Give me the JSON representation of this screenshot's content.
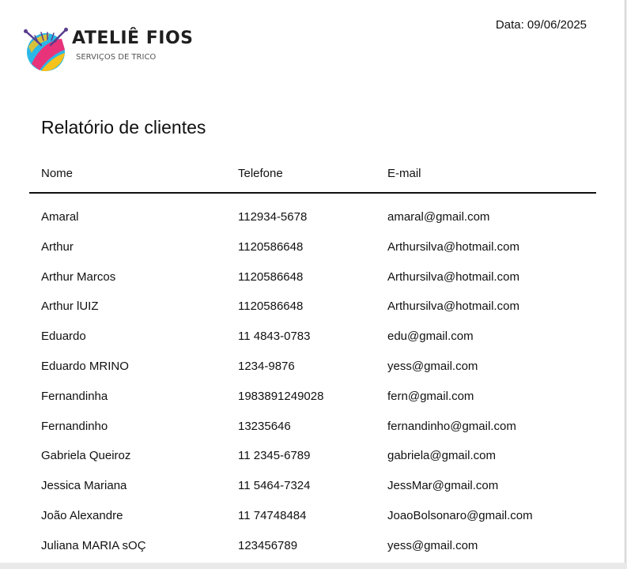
{
  "header": {
    "brand": "ATELIÊ FIOS",
    "tagline": "SERVIÇOS DE TRICO",
    "logo_icon": "yarn-ball-knitting-needles-icon",
    "date_text": "Data: 09/06/2025"
  },
  "report": {
    "title": "Relatório de clientes",
    "columns": {
      "name": "Nome",
      "phone": "Telefone",
      "email": "E-mail"
    },
    "rows": [
      {
        "name": "Amaral",
        "phone": "112934-5678",
        "email": "amaral@gmail.com"
      },
      {
        "name": "Arthur",
        "phone": "1120586648",
        "email": "Arthursilva@hotmail.com"
      },
      {
        "name": "Arthur Marcos",
        "phone": "1120586648",
        "email": "Arthursilva@hotmail.com"
      },
      {
        "name": "Arthur lUIZ",
        "phone": "1120586648",
        "email": "Arthursilva@hotmail.com"
      },
      {
        "name": "Eduardo",
        "phone": "11 4843-0783",
        "email": "edu@gmail.com"
      },
      {
        "name": "Eduardo MRINO",
        "phone": "1234-9876",
        "email": "yess@gmail.com"
      },
      {
        "name": "Fernandinha",
        "phone": "1983891249028",
        "email": "fern@gmail.com"
      },
      {
        "name": "Fernandinho",
        "phone": "13235646",
        "email": "fernandinho@gmail.com"
      },
      {
        "name": "Gabriela Queiroz",
        "phone": "11 2345-6789",
        "email": "gabriela@gmail.com"
      },
      {
        "name": "Jessica Mariana",
        "phone": "11 5464-7324",
        "email": "JessMar@gmail.com"
      },
      {
        "name": "João Alexandre",
        "phone": "11 74748484",
        "email": "JoaoBolsonaro@gmail.com"
      },
      {
        "name": "Juliana MARIA sOÇ",
        "phone": "123456789",
        "email": "yess@gmail.com"
      }
    ]
  },
  "colors": {
    "text": "#111111",
    "rule": "#111111",
    "logo_cyan": "#2bb8e6",
    "logo_pink": "#e8337a",
    "logo_yellow": "#f6c21c",
    "logo_purple": "#5a3d8f"
  }
}
